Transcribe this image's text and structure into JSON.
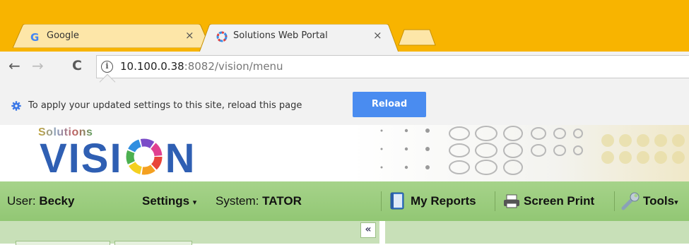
{
  "browser": {
    "tabs": [
      {
        "label": "Google",
        "favicon": "google-g-icon",
        "active": false
      },
      {
        "label": "Solutions Web Portal",
        "favicon": "vision-logo-icon",
        "active": true
      }
    ],
    "close_glyph": "×",
    "nav": {
      "back": "←",
      "forward": "→",
      "reload": "C"
    },
    "url_host": "10.100.0.38",
    "url_rest": ":8082/vision/menu",
    "info_glyph": "i"
  },
  "infobar": {
    "message": "To apply your updated settings to this site, reload this page",
    "button_label": "Reload"
  },
  "banner": {
    "small_logo": "Solutions",
    "logo_left": "VISI",
    "logo_right": "N"
  },
  "menubar": {
    "user_label": "User:",
    "user_name": "Becky",
    "settings_label": "Settings",
    "system_label": "System:",
    "system_name": "TATOR",
    "my_reports": "My Reports",
    "screen_print": "Screen Print",
    "tools": "Tools"
  },
  "panel": {
    "collapse_glyph": "«"
  },
  "colors": {
    "tabstrip": "#f8b400",
    "reload_button": "#4a8cf0",
    "menubar": "#a6d38a",
    "logo_blue": "#2f5fb3"
  }
}
